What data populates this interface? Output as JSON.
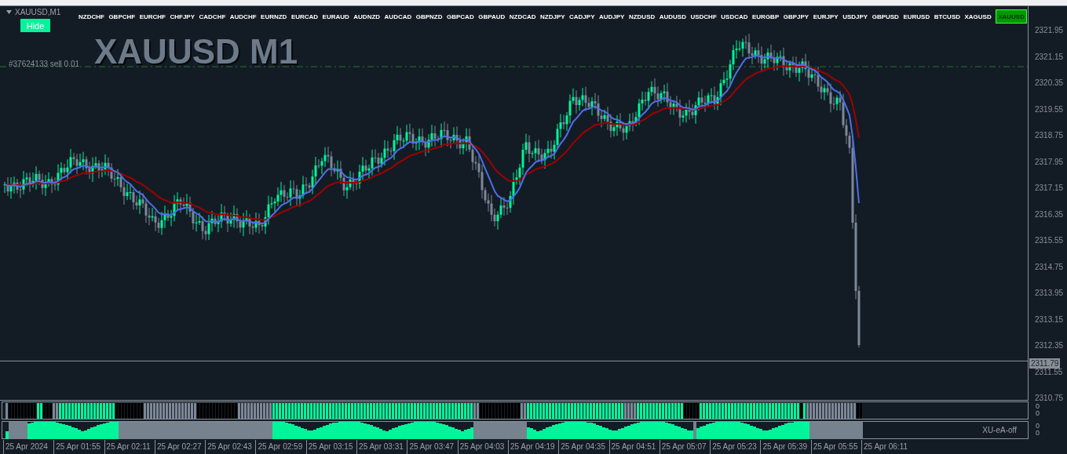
{
  "window": {
    "title": "XAUUSD,M1"
  },
  "hide_button": "Hide",
  "chart_title": "XAUUSD M1",
  "order_label": "#37624133 sell 0.01",
  "symbols": [
    {
      "label": "NZDCHF",
      "selected": false
    },
    {
      "label": "GBPCHF",
      "selected": false
    },
    {
      "label": "EURCHF",
      "selected": false
    },
    {
      "label": "CHFJPY",
      "selected": false
    },
    {
      "label": "CADCHF",
      "selected": false
    },
    {
      "label": "AUDCHF",
      "selected": false
    },
    {
      "label": "EURNZD",
      "selected": false
    },
    {
      "label": "EURCAD",
      "selected": false
    },
    {
      "label": "EURAUD",
      "selected": false
    },
    {
      "label": "AUDNZD",
      "selected": false
    },
    {
      "label": "AUDCAD",
      "selected": false
    },
    {
      "label": "GBPNZD",
      "selected": false
    },
    {
      "label": "GBPCAD",
      "selected": false
    },
    {
      "label": "GBPAUD",
      "selected": false
    },
    {
      "label": "NZDCAD",
      "selected": false
    },
    {
      "label": "NZDJPY",
      "selected": false
    },
    {
      "label": "CADJPY",
      "selected": false
    },
    {
      "label": "AUDJPY",
      "selected": false
    },
    {
      "label": "NZDUSD",
      "selected": false
    },
    {
      "label": "AUDUSD",
      "selected": false
    },
    {
      "label": "USDCHF",
      "selected": false
    },
    {
      "label": "USDCAD",
      "selected": false
    },
    {
      "label": "EURGBP",
      "selected": false
    },
    {
      "label": "GBPJPY",
      "selected": false
    },
    {
      "label": "EURJPY",
      "selected": false
    },
    {
      "label": "USDJPY",
      "selected": false
    },
    {
      "label": "GBPUSD",
      "selected": false
    },
    {
      "label": "EURUSD",
      "selected": false
    },
    {
      "label": "BTCUSD",
      "selected": false
    },
    {
      "label": "XAGUSD",
      "selected": false
    },
    {
      "label": "XAUUSD",
      "selected": true
    }
  ],
  "price_axis": {
    "ticks": [
      "2321.95",
      "2321.15",
      "2320.35",
      "2319.55",
      "2318.75",
      "2317.95",
      "2317.15",
      "2316.35",
      "2315.55",
      "2314.75",
      "2313.95",
      "2313.15",
      "2312.35",
      "2311.55",
      "2310.75"
    ],
    "current_price": "2311.79"
  },
  "indicators": [
    {
      "scale_labels": [
        "0",
        "0"
      ]
    },
    {
      "label": "XU-eA-off",
      "scale_labels": [
        "0",
        "0"
      ]
    }
  ],
  "time_axis": [
    "25 Apr 2024",
    "25 Apr 01:55",
    "25 Apr 02:11",
    "25 Apr 02:27",
    "25 Apr 02:43",
    "25 Apr 02:59",
    "25 Apr 03:15",
    "25 Apr 03:31",
    "25 Apr 03:47",
    "25 Apr 04:03",
    "25 Apr 04:19",
    "25 Apr 04:35",
    "25 Apr 04:51",
    "25 Apr 05:07",
    "25 Apr 05:23",
    "25 Apr 05:39",
    "25 Apr 05:55",
    "25 Apr 06:11"
  ]
}
